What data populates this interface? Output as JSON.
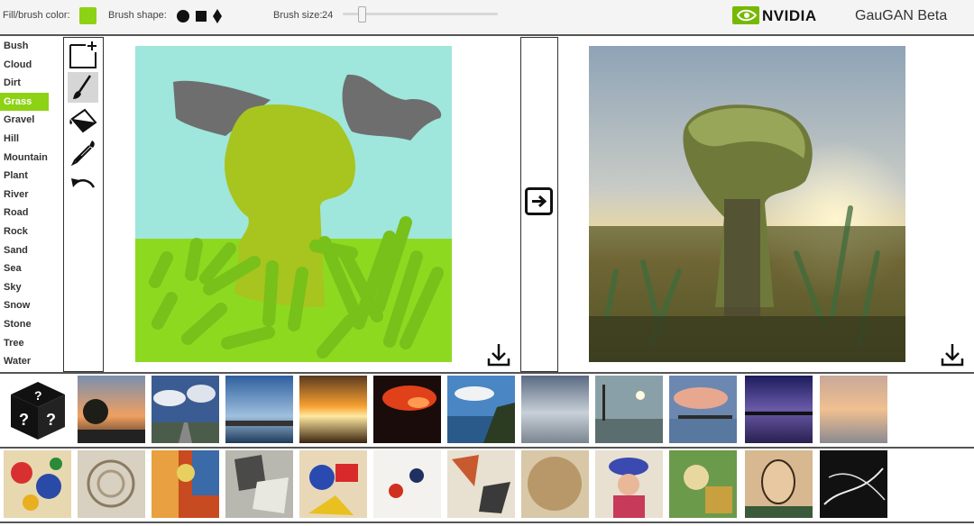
{
  "topbar": {
    "fill_label": "Fill/brush color:",
    "fill_color": "#8dd214",
    "shape_label": "Brush shape:",
    "shapes": [
      "circle-icon",
      "square-icon",
      "diamond-icon"
    ],
    "size_label": "Brush size:",
    "size_value": "24",
    "brand": "NVIDIA",
    "app_title": "GauGAN Beta"
  },
  "labels": [
    "Bush",
    "Cloud",
    "Dirt",
    "Grass",
    "Gravel",
    "Hill",
    "Mountain",
    "Plant",
    "River",
    "Road",
    "Rock",
    "Sand",
    "Sea",
    "Sky",
    "Snow",
    "Stone",
    "Tree",
    "Water"
  ],
  "selected_label": "Grass",
  "tools": [
    "new-canvas-icon",
    "brush-icon",
    "fill-bucket-icon",
    "eyedropper-icon",
    "undo-icon"
  ],
  "active_tool": "brush-icon",
  "colors": {
    "accent": "#8dd214",
    "sky": "#9fe6dc",
    "grass": "#8dd920",
    "rock": "#6e6e6e",
    "tree": "#a8c41e",
    "plant": "#78c01a"
  },
  "style_rows": {
    "row1": [
      "random-style",
      "sunset-trees",
      "stormy-clouds-road",
      "blue-sky-shore",
      "orange-sunset-sea",
      "red-sky-night",
      "coastal-cliffs",
      "grey-sky-beach",
      "tree-on-shore",
      "pink-clouds-lake",
      "purple-dusk-lake",
      "misty-sunset-sea"
    ],
    "row2": [
      "kandinsky-circles",
      "mosaic-swirl",
      "rainy-street-painting",
      "cubist-portrait",
      "abstract-colors",
      "hand-print",
      "cubist-fragments",
      "sepia-texture",
      "matisse-woman",
      "picasso-still-life",
      "picasso-self-portrait",
      "black-white-lines"
    ]
  }
}
